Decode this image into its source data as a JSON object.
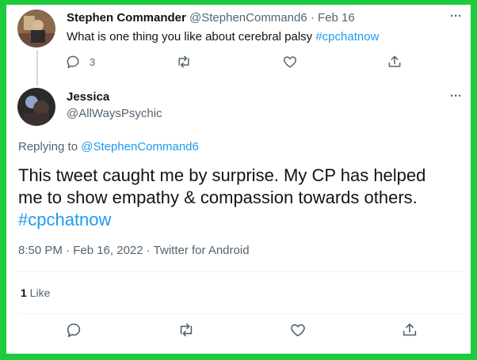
{
  "parent_tweet": {
    "author_name": "Stephen Commander",
    "author_handle": "@StephenCommand6",
    "separator": "·",
    "date": "Feb 16",
    "text_prefix": "What is one thing you like about cerebral palsy ",
    "hashtag": "#cpchatnow",
    "reply_count": "3",
    "more_label": "···"
  },
  "reply_tweet": {
    "author_name": "Jessica",
    "author_handle": "@AllWaysPsychic",
    "more_label": "···",
    "replying_to_label": "Replying to ",
    "replying_to_handle": "@StephenCommand6",
    "text_line1": "This tweet caught me by surprise. My CP has helped",
    "text_line2": "me to show empathy & compassion towards others.",
    "hashtag": "#cpchatnow",
    "timestamp": "8:50 PM · Feb 16, 2022 · Twitter for Android",
    "like_count": "1",
    "like_label": " Like"
  },
  "icons": [
    "reply-icon",
    "retweet-icon",
    "like-icon",
    "share-icon",
    "more-icon"
  ],
  "colors": {
    "border": "#1ecb3c",
    "link": "#1d9bf0",
    "muted": "#536471"
  }
}
